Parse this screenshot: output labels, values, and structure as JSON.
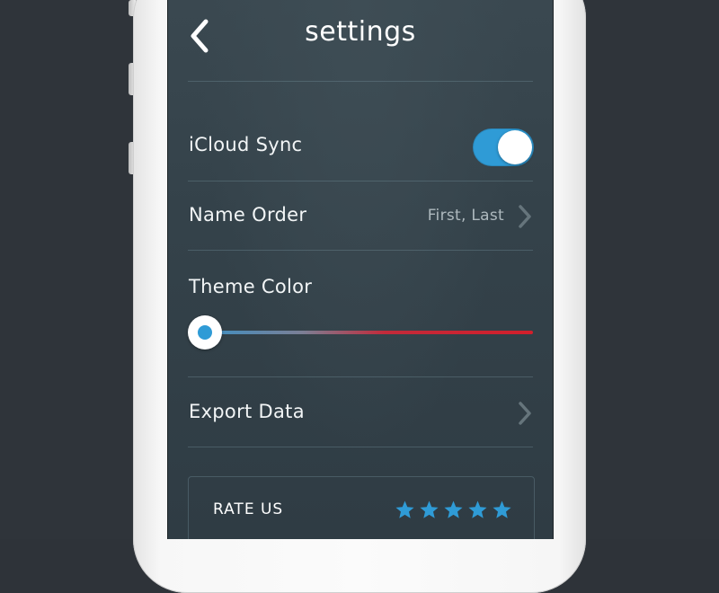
{
  "header": {
    "title": "settings",
    "back_icon": "chevron-left-icon"
  },
  "settings": {
    "icloud_sync": {
      "label": "iCloud Sync",
      "enabled": true
    },
    "name_order": {
      "label": "Name Order",
      "value": "First, Last"
    },
    "theme_color": {
      "label": "Theme Color",
      "slider_level": 0.0
    },
    "export_data": {
      "label": "Export Data"
    }
  },
  "rate": {
    "label": "RATE US",
    "stars": 5
  },
  "colors": {
    "accent": "#2f9bd6",
    "screen_bg": "#34424a",
    "page_bg": "#2f343a",
    "slider_end": "#d21f2b"
  }
}
